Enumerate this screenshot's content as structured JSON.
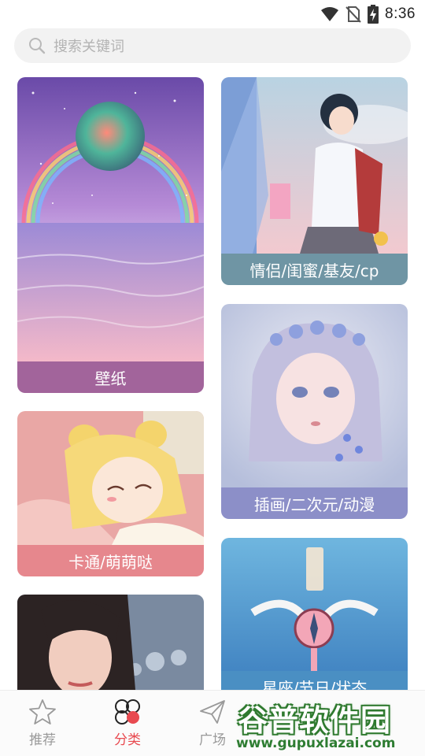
{
  "status_bar": {
    "time": "8:36"
  },
  "search": {
    "placeholder": "搜索关键词"
  },
  "categories": {
    "wallpaper": {
      "label": "壁纸",
      "label_color": "#a2649b"
    },
    "couple": {
      "label": "情侣/闺蜜/基友/cp",
      "label_color": "#6f95a4"
    },
    "cartoon": {
      "label": "卡通/萌萌哒",
      "label_color": "#e6878d"
    },
    "illustration": {
      "label": "插画/二次元/动漫",
      "label_color": "#8c8fc8"
    },
    "constellation": {
      "label": "星座/节日/状态",
      "label_color": "#4a8fc3"
    },
    "people": {
      "label": ""
    }
  },
  "bottom_nav": {
    "items": [
      {
        "label": "推荐",
        "icon": "star-icon",
        "active": false
      },
      {
        "label": "分类",
        "icon": "category-icon",
        "active": true
      },
      {
        "label": "广场",
        "icon": "send-icon",
        "active": false
      }
    ],
    "active_color": "#e84a50"
  },
  "watermark": {
    "title": "谷普软件园",
    "url": "www.gupuxlazai.com"
  }
}
